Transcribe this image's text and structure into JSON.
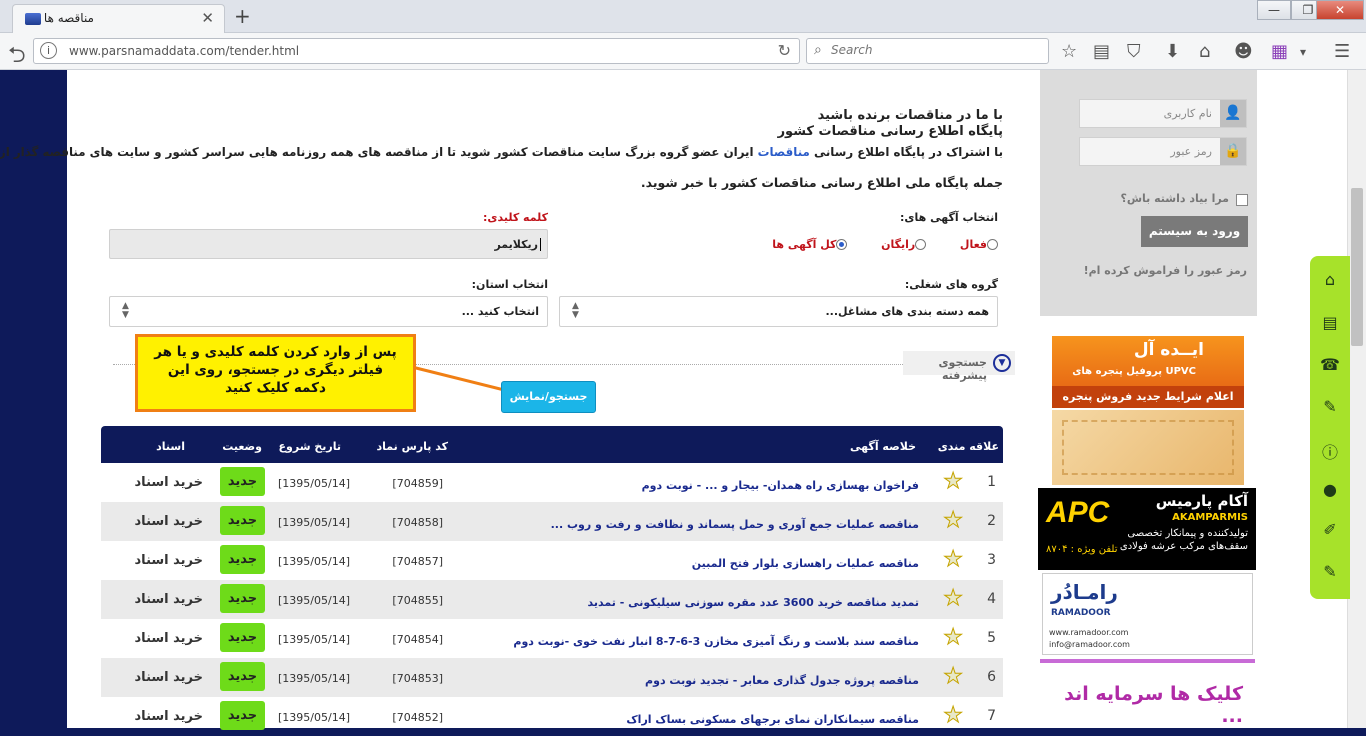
{
  "browser": {
    "tab_title": "مناقصه ها",
    "url": "www.parsnamaddata.com/tender.html",
    "search_placeholder": "Search"
  },
  "intro": {
    "line1": "با ما در مناقصات برنده باشید",
    "line2": "پایگاه اطلاع رسانی مناقصات کشور",
    "para_line1_a": "با اشتراک در پایگاه اطلاع رسانی",
    "para_line1_link": "مناقصات",
    "para_line1_b": "ایران عضو گروه بزرگ سایت مناقصات کشور شوید تا از مناقصه های همه روزنامه هایی سراسر کشور و سایت های مناقصه گذار از",
    "para_line2": "جمله پایگاه ملی اطلاع رسانی مناقصات کشور با خبر شوید."
  },
  "filters": {
    "ad_select_label": "انتخاب آگهی های:",
    "radio_active": "فعال",
    "radio_free": "رایگان",
    "radio_all": "کل آگهی ها",
    "keyword_label": "کلمه کلیدی:",
    "keyword_value": "ریکلایمر",
    "job_group_label": "گروه های شغلی:",
    "job_group_value": "همه دسته بندی های مشاغل...",
    "province_label": "انتخاب استان:",
    "province_value": "انتخاب کنید ...",
    "advanced_label": "جستجوی پیشرفته",
    "search_button": "جستجو/نمایش"
  },
  "annotation": {
    "line1": "پس از وارد کردن کلمه کلیدی و یا هر",
    "line2": "فیلتر دیگری در جستجو، روی این",
    "line3": "دکمه کلیک کنید"
  },
  "table": {
    "headers": {
      "favorite": "علاقه مندی",
      "summary": "خلاصه آگهی",
      "code": "کد پارس نماد",
      "start": "تاریخ شروع",
      "status": "وضعیت",
      "docs": "اسناد"
    },
    "rows": [
      {
        "n": "1",
        "title": "فراخوان بهسازی راه همدان- بیجار و ... - نوبت دوم",
        "code": "[704859]",
        "date": "[1395/05/14]",
        "status": "جدید",
        "buy": "خرید اسناد"
      },
      {
        "n": "2",
        "title": "مناقصه عملیات جمع آوری و حمل پسماند و نظافت و رفت و روب ...",
        "code": "[704858]",
        "date": "[1395/05/14]",
        "status": "جدید",
        "buy": "خرید اسناد"
      },
      {
        "n": "3",
        "title": "مناقصه عملیات راهسازی بلوار فتح المبین",
        "code": "[704857]",
        "date": "[1395/05/14]",
        "status": "جدید",
        "buy": "خرید اسناد"
      },
      {
        "n": "4",
        "title": "تمدید مناقصه خرید 3600 عدد مقره سوزنی سیلیکونی - تمدید",
        "code": "[704855]",
        "date": "[1395/05/14]",
        "status": "جدید",
        "buy": "خرید اسناد"
      },
      {
        "n": "5",
        "title": "مناقصه سند بلاست و رنگ آمیزی مخازن 3-6-7-8 انبار نفت خوی -نوبت دوم",
        "code": "[704854]",
        "date": "[1395/05/14]",
        "status": "جدید",
        "buy": "خرید اسناد"
      },
      {
        "n": "6",
        "title": "مناقصه پروژه جدول گذاری معابر - تجدید نوبت دوم",
        "code": "[704853]",
        "date": "[1395/05/14]",
        "status": "جدید",
        "buy": "خرید اسناد"
      },
      {
        "n": "7",
        "title": "مناقصه سیمانکاران نمای برجهای مسکونی بساک اراک",
        "code": "[704852]",
        "date": "[1395/05/14]",
        "status": "جدید",
        "buy": "خرید اسناد"
      }
    ]
  },
  "sidebar": {
    "username_placeholder": "نام کاربری",
    "password_placeholder": "رمز عبور",
    "remember": "مرا بیاد داشته باش؟",
    "login_button": "ورود به سیستم",
    "forgot": "رمز عبور را فراموش کرده ام!"
  },
  "ads": {
    "idea_title": "ایــده آل",
    "idea_sub": "UPVC پروفیل پنجره های",
    "idea_cta": "اعلام شرایط جدید فروش پنجره",
    "apc_brand": "آکام پارمیس",
    "apc_latin": "AKAMPARMIS",
    "apc_line1": "تولیدکننده و پیمانکار تخصصی",
    "apc_line2": "سقف‌های مرکب عرشه فولادی",
    "apc_phone": "تلفن ویژه : ۸۷۰۴",
    "ramadoor_title": "رامـادُر",
    "ramadoor_latin": "RAMADOOR",
    "ramadoor_web": "www.ramadoor.com",
    "ramadoor_email": "info@ramadoor.com",
    "invest": "کلیک ها سرمایه اند ..."
  },
  "colors": {
    "navy": "#0e1a5a",
    "accent_red": "#c0141b",
    "badge_green": "#6edb19",
    "button_blue": "#1bb5e8",
    "annotation_yellow": "#fff100",
    "annotation_border": "#f07f14"
  }
}
